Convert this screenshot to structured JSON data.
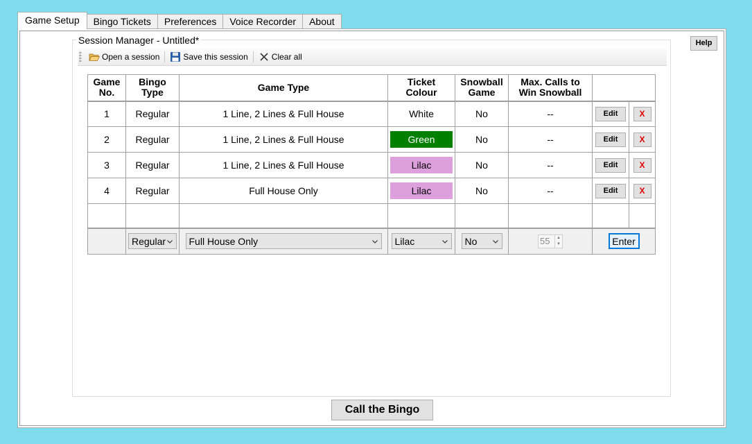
{
  "tabs": [
    "Game Setup",
    "Bingo Tickets",
    "Preferences",
    "Voice Recorder",
    "About"
  ],
  "help_label": "Help",
  "session": {
    "title": "Session Manager - Untitled*",
    "toolbar": {
      "open": "Open a session",
      "save": "Save this session",
      "clear": "Clear all"
    }
  },
  "table": {
    "headers": {
      "game_no": "Game\nNo.",
      "bingo_type": "Bingo\nType",
      "game_type": "Game Type",
      "ticket_colour": "Ticket\nColour",
      "snowball": "Snowball\nGame",
      "max_calls": "Max. Calls to\nWin Snowball"
    },
    "rows": [
      {
        "no": "1",
        "bingo_type": "Regular",
        "game_type": "1 Line, 2 Lines & Full House",
        "colour": "White",
        "colour_hex": "#ffffff",
        "text_hex": "#000000",
        "snowball": "No",
        "max_calls": "--"
      },
      {
        "no": "2",
        "bingo_type": "Regular",
        "game_type": "1 Line, 2 Lines & Full House",
        "colour": "Green",
        "colour_hex": "#008000",
        "text_hex": "#ffffff",
        "snowball": "No",
        "max_calls": "--"
      },
      {
        "no": "3",
        "bingo_type": "Regular",
        "game_type": "1 Line, 2 Lines & Full House",
        "colour": "Lilac",
        "colour_hex": "#dda0dd",
        "text_hex": "#000000",
        "snowball": "No",
        "max_calls": "--"
      },
      {
        "no": "4",
        "bingo_type": "Regular",
        "game_type": "Full House Only",
        "colour": "Lilac",
        "colour_hex": "#dda0dd",
        "text_hex": "#000000",
        "snowball": "No",
        "max_calls": "--"
      }
    ],
    "row_actions": {
      "edit": "Edit",
      "delete": "X"
    },
    "entry": {
      "bingo_type": "Regular",
      "game_type": "Full House Only",
      "colour": "Lilac",
      "snowball": "No",
      "max_calls": "55",
      "enter": "Enter"
    }
  },
  "call_button": "Call the Bingo"
}
